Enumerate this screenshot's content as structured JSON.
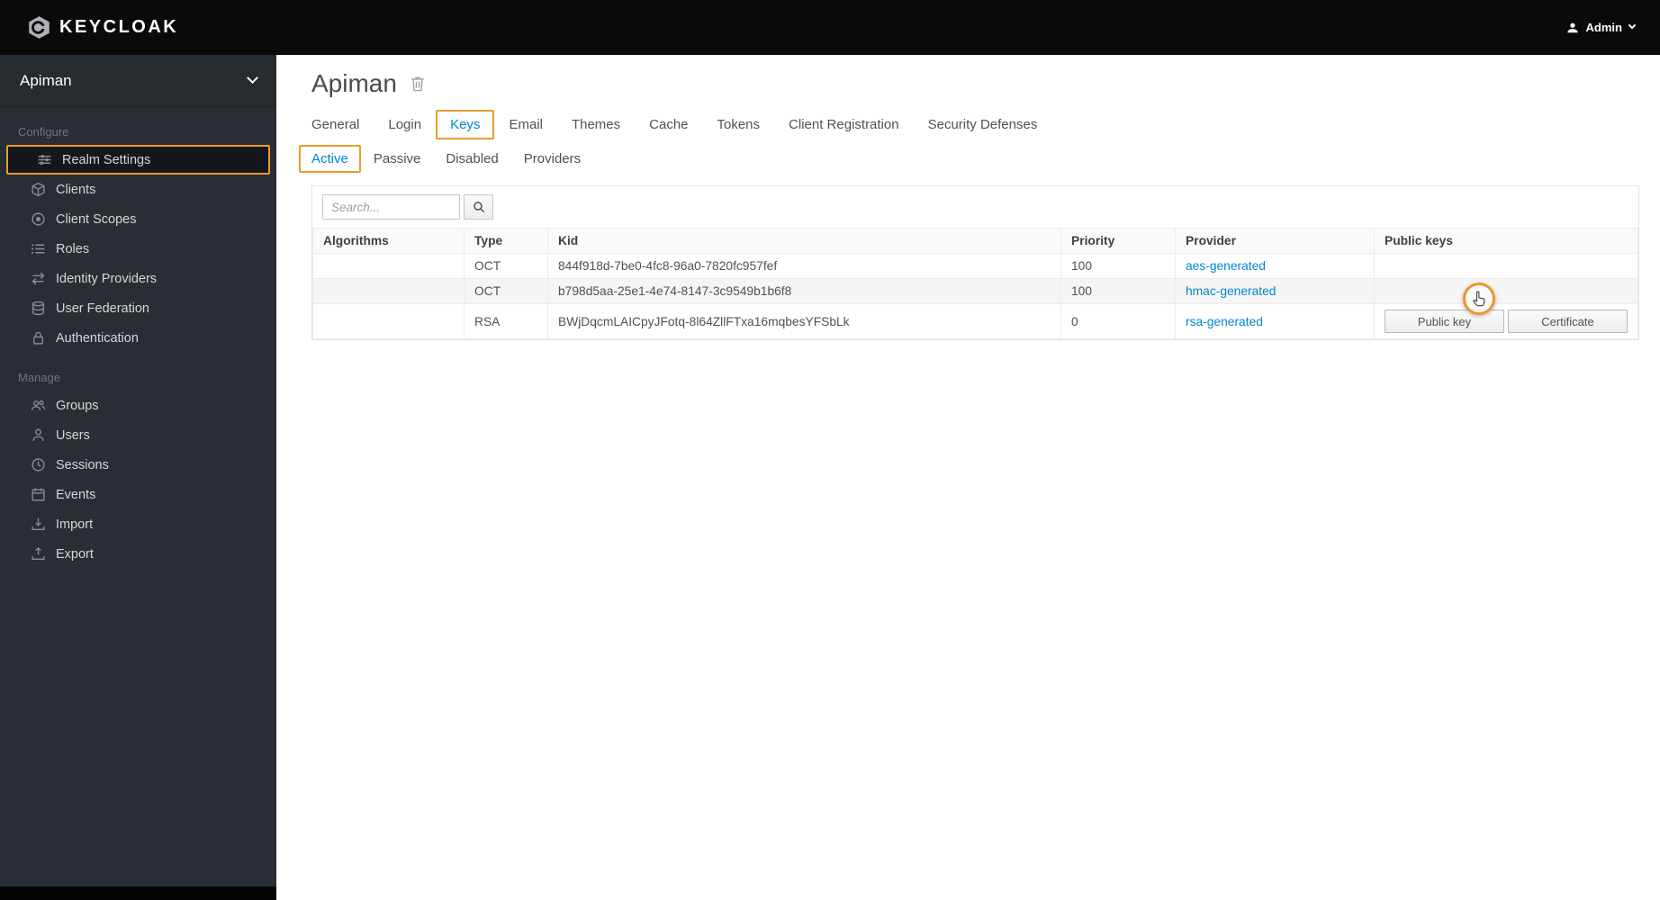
{
  "navbar": {
    "brand": "KEYCLOAK",
    "user_label": "Admin"
  },
  "sidebar": {
    "realm": "Apiman",
    "configure": {
      "label": "Configure",
      "items": [
        "Realm Settings",
        "Clients",
        "Client Scopes",
        "Roles",
        "Identity Providers",
        "User Federation",
        "Authentication"
      ]
    },
    "manage": {
      "label": "Manage",
      "items": [
        "Groups",
        "Users",
        "Sessions",
        "Events",
        "Import",
        "Export"
      ]
    }
  },
  "page": {
    "title": "Apiman"
  },
  "tabs": {
    "items": [
      "General",
      "Login",
      "Keys",
      "Email",
      "Themes",
      "Cache",
      "Tokens",
      "Client Registration",
      "Security Defenses"
    ],
    "active": "Keys"
  },
  "subtabs": {
    "items": [
      "Active",
      "Passive",
      "Disabled",
      "Providers"
    ],
    "active": "Active"
  },
  "search": {
    "placeholder": "Search..."
  },
  "table": {
    "headers": [
      "Algorithms",
      "Type",
      "Kid",
      "Priority",
      "Provider",
      "Public keys"
    ],
    "rows": [
      {
        "algorithms": "",
        "type": "OCT",
        "kid": "844f918d-7be0-4fc8-96a0-7820fc957fef",
        "priority": "100",
        "provider": "aes-generated"
      },
      {
        "algorithms": "",
        "type": "OCT",
        "kid": "b798d5aa-25e1-4e74-8147-3c9549b1b6f8",
        "priority": "100",
        "provider": "hmac-generated"
      },
      {
        "algorithms": "",
        "type": "RSA",
        "kid": "BWjDqcmLAICpyJFotq-8l64ZllFTxa16mqbesYFSbLk",
        "priority": "0",
        "provider": "rsa-generated",
        "actions": [
          "Public key",
          "Certificate"
        ]
      }
    ]
  },
  "colors": {
    "link": "#0088ce",
    "annotation": "#ee9b2d"
  }
}
